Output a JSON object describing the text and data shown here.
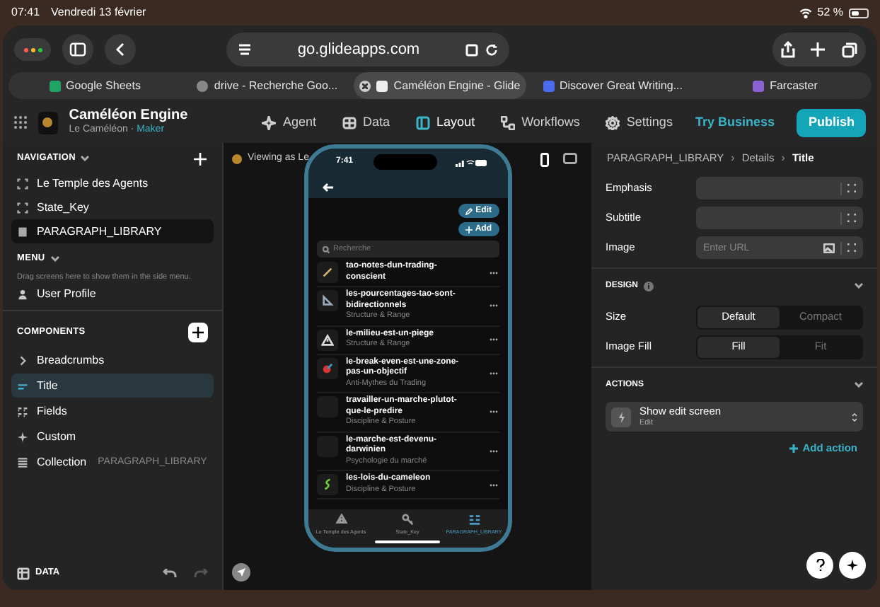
{
  "status_bar": {
    "time": "07:41",
    "date": "Vendredi 13 février",
    "battery": "52 %"
  },
  "browser": {
    "url": "go.glideapps.com",
    "tabs": [
      {
        "label": "Google Sheets",
        "selected": false
      },
      {
        "label": "drive - Recherche Goo...",
        "selected": false
      },
      {
        "label": "Caméléon Engine - Glide",
        "selected": true
      },
      {
        "label": "Discover Great Writing...",
        "selected": false
      },
      {
        "label": "Farcaster",
        "selected": false
      }
    ]
  },
  "app_header": {
    "app_name": "Caméléon Engine",
    "owner": "Le Caméléon",
    "owner_separator": "·",
    "role": "Maker",
    "nav": [
      {
        "label": "Agent",
        "selected": false
      },
      {
        "label": "Data",
        "selected": false
      },
      {
        "label": "Layout",
        "selected": true
      },
      {
        "label": "Workflows",
        "selected": false
      },
      {
        "label": "Settings",
        "selected": false
      }
    ],
    "try_business": "Try Business",
    "publish": "Publish"
  },
  "sidebar": {
    "navigation_title": "NAVIGATION",
    "navigation": [
      {
        "label": "Le Temple des Agents",
        "selected": false
      },
      {
        "label": "State_Key",
        "selected": false
      },
      {
        "label": "PARAGRAPH_LIBRARY",
        "selected": true
      }
    ],
    "menu_title": "MENU",
    "menu_hint": "Drag screens here to show them in the side menu.",
    "menu": [
      {
        "label": "User Profile"
      }
    ],
    "components_title": "COMPONENTS",
    "components": [
      {
        "label": "Breadcrumbs",
        "selected": false
      },
      {
        "label": "Title",
        "selected": true
      },
      {
        "label": "Fields",
        "selected": false
      },
      {
        "label": "Custom",
        "selected": false
      },
      {
        "label": "Collection",
        "detail": "PARAGRAPH_LIBRARY",
        "selected": false
      }
    ],
    "data_label": "DATA"
  },
  "canvas": {
    "viewing_as": "Viewing as Le",
    "phone": {
      "time": "7:41",
      "edit": "Edit",
      "add": "Add",
      "search_placeholder": "Recherche",
      "items": [
        {
          "title": "tao-notes-dun-trading-conscient"
        },
        {
          "title": "les-pourcentages-tao-sont-bidirectionnels",
          "subtitle": "Structure & Range"
        },
        {
          "title": "le-milieu-est-un-piege",
          "subtitle": "Structure & Range"
        },
        {
          "title": "le-break-even-est-une-zone-pas-un-objectif",
          "subtitle": "Anti-Mythes du Trading"
        },
        {
          "title": "travailler-un-marche-plutot-que-le-predire",
          "subtitle": "Discipline & Posture"
        },
        {
          "title": "le-marche-est-devenu-darwinien",
          "subtitle": "Psychologie du marché"
        },
        {
          "title": "les-lois-du-cameleon",
          "subtitle": "Discipline & Posture"
        }
      ],
      "tabbar": [
        {
          "label": "Le Temple des Agents",
          "selected": false
        },
        {
          "label": "State_Key",
          "selected": false
        },
        {
          "label": "PARAGRAPH_LIBRARY",
          "selected": true
        }
      ]
    }
  },
  "inspector": {
    "breadcrumb": [
      "PARAGRAPH_LIBRARY",
      "Details",
      "Title"
    ],
    "breadcrumb_separator": "›",
    "fields": [
      {
        "label": "Emphasis"
      },
      {
        "label": "Subtitle"
      },
      {
        "label": "Image",
        "placeholder": "Enter URL"
      }
    ],
    "design_title": "DESIGN",
    "design": [
      {
        "label": "Size",
        "options": [
          {
            "label": "Default",
            "selected": true
          },
          {
            "label": "Compact",
            "selected": false
          }
        ]
      },
      {
        "label": "Image Fill",
        "options": [
          {
            "label": "Fill",
            "selected": true
          },
          {
            "label": "Fit",
            "selected": false
          }
        ]
      }
    ],
    "actions_title": "ACTIONS",
    "actions": [
      {
        "title": "Show edit screen",
        "subtitle": "Edit"
      }
    ],
    "add_action": "Add action"
  }
}
